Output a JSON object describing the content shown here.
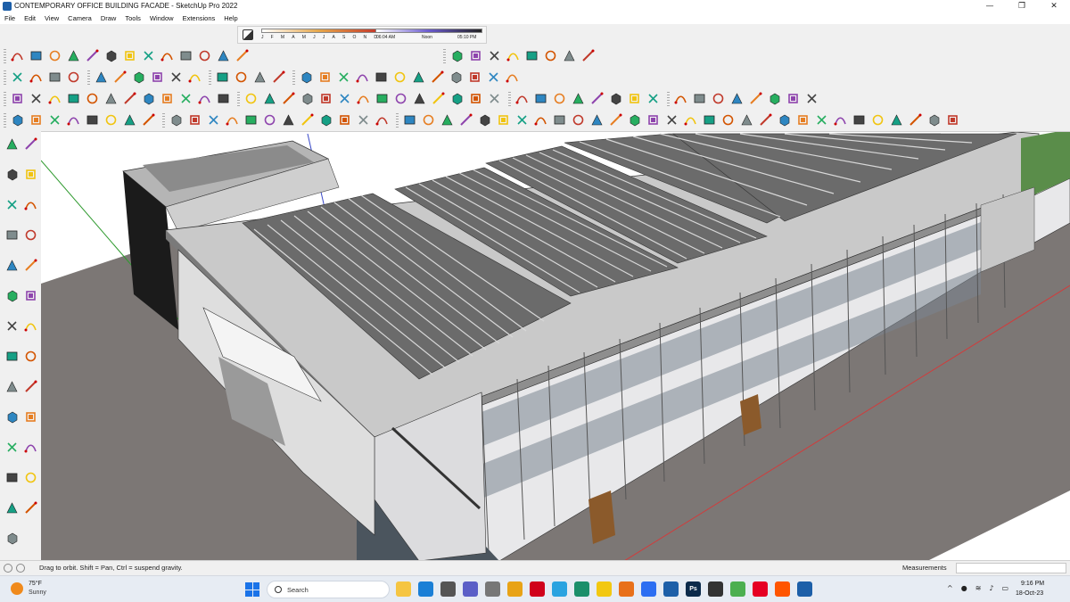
{
  "window": {
    "title": "CONTEMPORARY OFFICE BUILDING FACADE - SketchUp Pro 2022",
    "minimize": "—",
    "maximize": "❐",
    "close": "✕"
  },
  "menu": [
    "File",
    "Edit",
    "View",
    "Camera",
    "Draw",
    "Tools",
    "Window",
    "Extensions",
    "Help"
  ],
  "shadows": {
    "months": [
      "J",
      "F",
      "M",
      "A",
      "M",
      "J",
      "J",
      "A",
      "S",
      "O",
      "N",
      "D"
    ],
    "time_start": "06:04 AM",
    "time_mid": "Noon",
    "time_end": "05:10 PM"
  },
  "status": {
    "hint": "Drag to orbit. Shift = Pan, Ctrl = suspend gravity.",
    "measurements_label": "Measurements",
    "measurements_value": ""
  },
  "taskbar": {
    "weather_temp": "75°F",
    "weather_condition": "Sunny",
    "search_label": "Search",
    "time": "9:16 PM",
    "date": "18-Oct-23",
    "tray": [
      "^",
      "●",
      "≋",
      "♪",
      "▭"
    ]
  },
  "colors": {
    "accent": "#1a73e8",
    "sky": "#ffffff",
    "ground": "#7c7775",
    "roof_concrete": "#9b9b9b",
    "facade_panel": "#e8e8ea",
    "axis_red": "#d23b3b",
    "axis_green": "#2f9a2f",
    "axis_blue": "#3848c8"
  },
  "icons": {
    "toolbar_row1": [
      "freehand-icon",
      "arc-icon",
      "rect-icon",
      "push-pull-icon",
      "offset-icon",
      "follow-me-icon",
      "sandbox-icon",
      "extend-icon",
      "trim-icon",
      "section-icon",
      "camera-icon",
      "shadow-icon",
      "fog-icon"
    ],
    "left_tools": [
      "select-icon",
      "orbit-icon",
      "paint-bucket-icon",
      "eraser-icon",
      "line-icon",
      "arc-icon",
      "rectangle-icon",
      "circle-icon",
      "polygon-icon",
      "push-pull-icon",
      "move-icon",
      "rotate-icon",
      "scale-icon",
      "follow-me-icon",
      "offset-icon",
      "tape-measure-icon",
      "protractor-icon",
      "text-icon",
      "axes-icon",
      "dimension-icon",
      "pan-icon",
      "zoom-icon",
      "zoom-extents-icon",
      "walk-icon",
      "look-around-icon",
      "position-camera-icon",
      "section-plane-icon"
    ]
  }
}
